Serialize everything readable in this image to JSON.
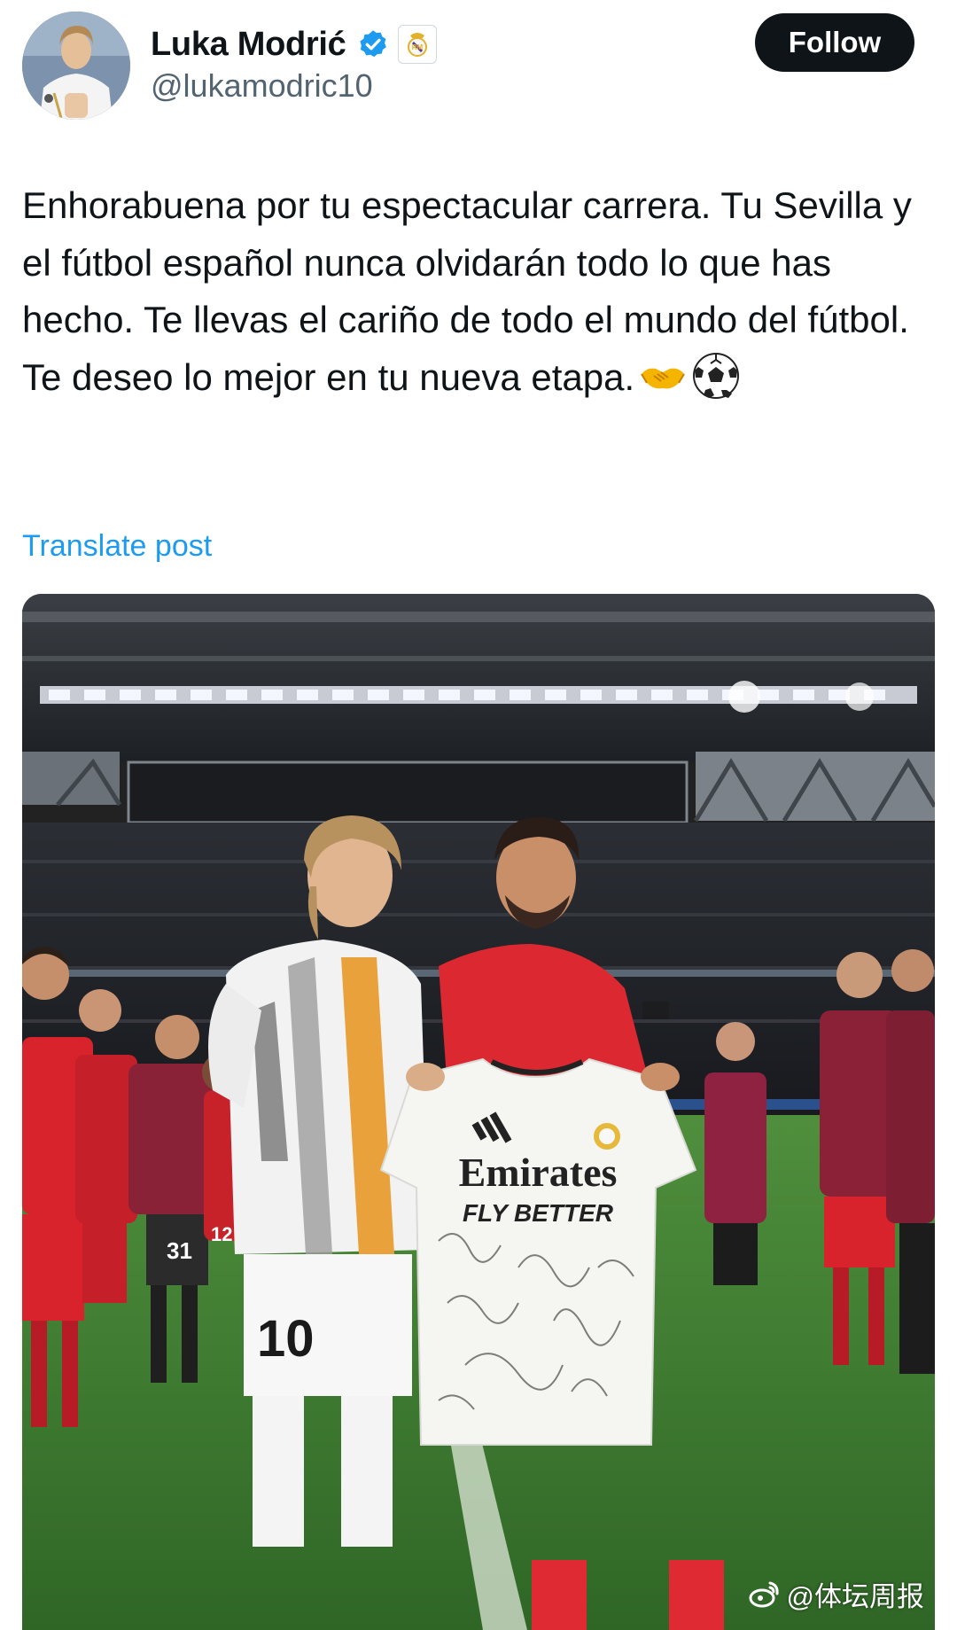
{
  "user": {
    "display_name": "Luka Modrić",
    "handle": "@lukamodric10",
    "verified": true,
    "affiliate_badge": "real-madrid-crest",
    "avatar": "profile-photo-white-kit-clapping"
  },
  "actions": {
    "follow_label": "Follow"
  },
  "post": {
    "text": "Enhorabuena por tu espectacular carrera. Tu Sevilla y el fútbol español nunca olvidarán todo lo que has hecho. Te llevas el cariño de todo el mundo del fútbol. Te deseo lo mejor en tu nueva etapa.",
    "emojis": [
      "handshake-emoji",
      "soccer-ball-emoji"
    ],
    "translate_label": "Translate post"
  },
  "media": {
    "type": "photo",
    "jersey_sponsor": "Emirates",
    "jersey_tagline": "FLY BETTER",
    "shorts_number": "10",
    "player_number_31": "31",
    "player_number_12": "12",
    "watermark": "@体坛周报"
  },
  "colors": {
    "text_primary": "#0f1419",
    "text_secondary": "#536471",
    "link": "#1d9bf0",
    "follow_bg": "#0f1419",
    "verified": "#1d9bf0",
    "pitch": "#3f7a33",
    "sevilla_red": "#d91e2a"
  }
}
